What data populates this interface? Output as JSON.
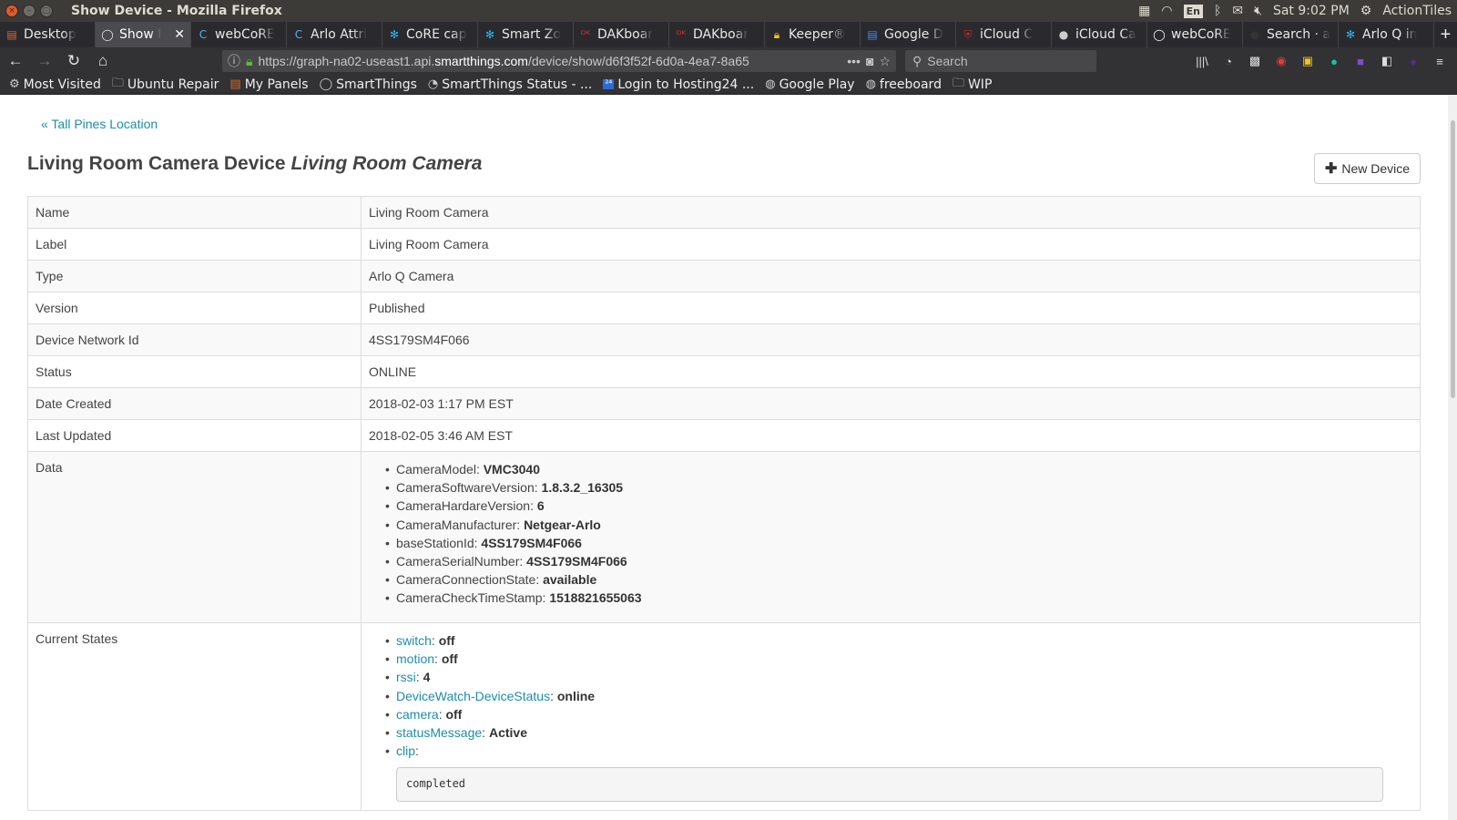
{
  "window": {
    "title": "Show Device - Mozilla Firefox"
  },
  "tray": {
    "lang": "En",
    "clock": "Sat  9:02 PM",
    "app": "ActionTiles"
  },
  "tabs": [
    {
      "label": "Desktop",
      "icon": "panel-icon",
      "color": "#e8661b"
    },
    {
      "label": "Show I",
      "icon": "smartthings-icon",
      "color": "#e8e8e8",
      "active": true
    },
    {
      "label": "webCoRE",
      "icon": "webcore-icon",
      "color": "#56aff0"
    },
    {
      "label": "Arlo Attri",
      "icon": "webcore-icon",
      "color": "#56aff0"
    },
    {
      "label": "CoRE cap",
      "icon": "snowflake-icon",
      "color": "#28b6f6"
    },
    {
      "label": "Smart Zo",
      "icon": "snowflake-icon",
      "color": "#28b6f6"
    },
    {
      "label": "DAKboar",
      "icon": "dak-icon",
      "color": "#d32f2f"
    },
    {
      "label": "DAKboar",
      "icon": "dak-icon",
      "color": "#d32f2f"
    },
    {
      "label": "Keeper®",
      "icon": "keeper-icon",
      "color": "#f4c21a"
    },
    {
      "label": "Google D",
      "icon": "doc-icon",
      "color": "#4a86e8"
    },
    {
      "label": "iCloud C",
      "icon": "shield-icon",
      "color": "#c62828"
    },
    {
      "label": "iCloud Ca",
      "icon": "apple-icon",
      "color": "#cccccc"
    },
    {
      "label": "webCoRE",
      "icon": "ring-icon",
      "color": "#ffffff"
    },
    {
      "label": "Search · a",
      "icon": "circle-icon",
      "color": "#333333"
    },
    {
      "label": "Arlo Q in",
      "icon": "snowflake-icon",
      "color": "#28b6f6"
    }
  ],
  "nav": {
    "url_pre": "https://graph-na02-useast1.api.",
    "url_domain": "smartthings.com",
    "url_post": "/device/show/d6f3f52f-6d0a-4ea7-8a65",
    "search_placeholder": "Search"
  },
  "bookmarks": [
    {
      "label": "Most Visited",
      "icon": "gear-icon"
    },
    {
      "label": "Ubuntu Repair",
      "icon": "folder-icon"
    },
    {
      "label": "My Panels",
      "icon": "panel-icon"
    },
    {
      "label": "SmartThings",
      "icon": "ring-icon"
    },
    {
      "label": "SmartThings Status - ...",
      "icon": "rss-icon"
    },
    {
      "label": "Login to Hosting24 ...",
      "icon": "h24-icon"
    },
    {
      "label": "Google Play",
      "icon": "globe-icon"
    },
    {
      "label": "freeboard",
      "icon": "globe-icon"
    },
    {
      "label": "WIP",
      "icon": "folder-icon"
    }
  ],
  "page": {
    "breadcrumb": "« Tall Pines Location",
    "heading_prefix": "Living Room Camera Device",
    "heading_name": "Living Room Camera",
    "new_device_label": "New Device"
  },
  "fields": [
    {
      "key": "Name",
      "value": "Living Room Camera"
    },
    {
      "key": "Label",
      "value": "Living Room Camera"
    },
    {
      "key": "Type",
      "value": "Arlo Q Camera"
    },
    {
      "key": "Version",
      "value": "Published"
    },
    {
      "key": "Device Network Id",
      "value": "4SS179SM4F066"
    },
    {
      "key": "Status",
      "value": "ONLINE"
    },
    {
      "key": "Date Created",
      "value": "2018-02-03 1:17 PM EST"
    },
    {
      "key": "Last Updated",
      "value": "2018-02-05 3:46 AM EST"
    }
  ],
  "data_label": "Data",
  "data_items": [
    {
      "k": "CameraModel",
      "v": "VMC3040"
    },
    {
      "k": "CameraSoftwareVersion",
      "v": "1.8.3.2_16305"
    },
    {
      "k": "CameraHardareVersion",
      "v": "6"
    },
    {
      "k": "CameraManufacturer",
      "v": "Netgear-Arlo"
    },
    {
      "k": "baseStationId",
      "v": "4SS179SM4F066"
    },
    {
      "k": "CameraSerialNumber",
      "v": "4SS179SM4F066"
    },
    {
      "k": "CameraConnectionState",
      "v": "available"
    },
    {
      "k": "CameraCheckTimeStamp",
      "v": "1518821655063"
    }
  ],
  "states_label": "Current States",
  "states": [
    {
      "k": "switch",
      "v": "off"
    },
    {
      "k": "motion",
      "v": "off"
    },
    {
      "k": "rssi",
      "v": "4"
    },
    {
      "k": "DeviceWatch-DeviceStatus",
      "v": "online"
    },
    {
      "k": "camera",
      "v": "off"
    },
    {
      "k": "statusMessage",
      "v": "Active"
    },
    {
      "k": "clip",
      "v": ""
    }
  ],
  "clip_value": "completed"
}
